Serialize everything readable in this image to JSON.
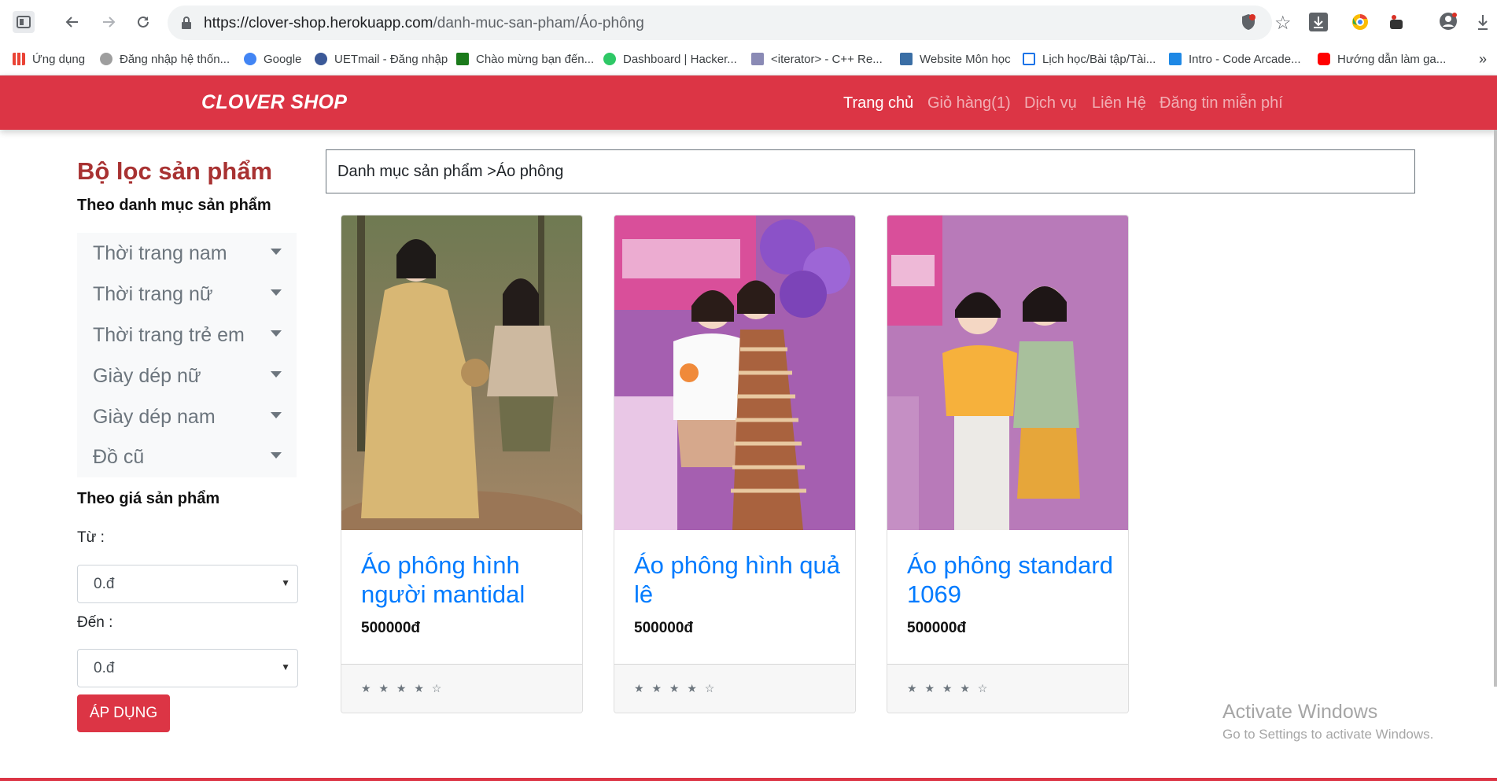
{
  "browser": {
    "url_host": "https://clover-shop.herokuapp.com",
    "url_path": "/danh-muc-san-pham/Áo-phông",
    "bookmarks": [
      {
        "label": "Ứng dụng",
        "color": "#ea4335"
      },
      {
        "label": "Đăng nhập hệ thốn...",
        "color": "#9e9e9e"
      },
      {
        "label": "Google",
        "color": "#4285f4"
      },
      {
        "label": "UETmail - Đăng nhập",
        "color": "#3b5998"
      },
      {
        "label": "Chào mừng bạn đến...",
        "color": "#1b7a1b"
      },
      {
        "label": "Dashboard | Hacker...",
        "color": "#2ec866"
      },
      {
        "label": "<iterator> - C++ Re...",
        "color": "#8a8ab5"
      },
      {
        "label": "Website Môn học",
        "color": "#3a6ea5"
      },
      {
        "label": "Lịch học/Bài tập/Tài...",
        "color": "#1a73e8"
      },
      {
        "label": "Intro - Code Arcade...",
        "color": "#1e88e5"
      },
      {
        "label": "Hướng dẫn làm ga...",
        "color": "#ff0000"
      }
    ],
    "more": "»"
  },
  "navbar": {
    "brand": "CLOVER SHOP",
    "links": [
      "Trang chủ",
      "Giỏ hàng(1)",
      "Dịch vụ",
      "Liên Hệ",
      "Đăng tin miễn phí"
    ],
    "accent": "#dc3545"
  },
  "sidebar": {
    "title": "Bộ lọc sản phẩm",
    "by_category": "Theo danh mục sản phẩm",
    "categories": [
      "Thời trang nam",
      "Thời trang nữ",
      "Thời trang trẻ em",
      "Giày dép nữ",
      "Giày dép nam",
      "Đồ cũ"
    ],
    "by_price": "Theo giá sản phẩm",
    "from_label": "Từ :",
    "from_value": "0.đ",
    "to_label": "Đến :",
    "to_value": "0.đ",
    "apply_label": "ÁP DỤNG"
  },
  "main": {
    "breadcrumb": "Danh mục sản phẩm >Áo phông",
    "products": [
      {
        "title": "Áo phông hình người mantidal",
        "price": "500000đ",
        "rating": "★ ★ ★ ★ ☆",
        "rating_value": 4
      },
      {
        "title": "Áo phông hình quả lê",
        "price": "500000đ",
        "rating": "★ ★ ★ ★ ☆",
        "rating_value": 4
      },
      {
        "title": "Áo phông standard 1069",
        "price": "500000đ",
        "rating": "★ ★ ★ ★ ☆",
        "rating_value": 4
      }
    ]
  },
  "watermark": {
    "line1": "Activate Windows",
    "line2": "Go to Settings to activate Windows."
  }
}
